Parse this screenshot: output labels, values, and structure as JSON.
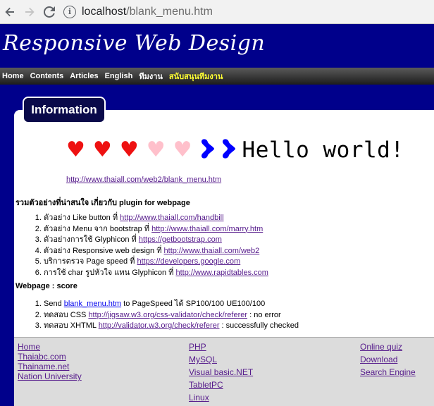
{
  "browser": {
    "url_host": "localhost",
    "url_path": "/blank_menu.htm",
    "back_icon": "arrow-left-icon",
    "forward_icon": "arrow-right-icon",
    "reload_icon": "reload-icon",
    "info_icon": "info-icon"
  },
  "header": {
    "title": "Responsive Web Design",
    "bg_color": "#00008b"
  },
  "menu": {
    "items": [
      {
        "label": "Home"
      },
      {
        "label": "Contents"
      },
      {
        "label": "Articles"
      },
      {
        "label": "English"
      },
      {
        "label": "ทีมงาน"
      },
      {
        "label": "สนับสนุนทีมงาน",
        "highlight": true
      }
    ]
  },
  "panel": {
    "tab_label": "Information",
    "hearts": [
      "♥",
      "♥",
      "♥",
      "♥",
      "♥",
      "♥",
      "♥"
    ],
    "hello": "Hello world!",
    "main_link": "http://www.thaiall.com/web2/blank_menu.htm"
  },
  "section1": {
    "heading": "รวมตัวอย่างที่น่าสนใจ เกี่ยวกับ plugin for webpage",
    "items": [
      {
        "text": "ตัวอย่าง Like button ที่ ",
        "link": "http://www.thaiall.com/handbill"
      },
      {
        "text": "ตัวอย่าง Menu จาก bootstrap ที่ ",
        "link": "http://www.thaiall.com/marry.htm"
      },
      {
        "text": "ตัวอย่างการใช้ Glyphicon ที่ ",
        "link": "https://getbootstrap.com"
      },
      {
        "text": "ตัวอย่าง Responsive web design ที่ ",
        "link": "http://www.thaiall.com/web2"
      },
      {
        "text": "บริการตรวจ Page speed ที่ ",
        "link": "https://developers.google.com"
      },
      {
        "text": "การใช้ char รูปหัวใจ แทน Glyphicon ที่ ",
        "link": "http://www.rapidtables.com"
      }
    ]
  },
  "section2": {
    "heading": "Webpage : score",
    "items": [
      {
        "prefix": "Send ",
        "link": "blank_menu.htm",
        "suffix": " to PageSpeed ได้ SP100/100 UE100/100"
      },
      {
        "prefix": "ทดสอบ CSS ",
        "link": "http://jigsaw.w3.org/css-validator/check/referer",
        "suffix": " : no error"
      },
      {
        "prefix": "ทดสอบ XHTML ",
        "link": "http://validator.w3.org/check/referer",
        "suffix": " : successfully checked"
      }
    ]
  },
  "footer": {
    "col1": [
      "Home",
      "Thaiabc.com",
      "Thainame.net",
      "Nation University"
    ],
    "col2": [
      "PHP",
      "MySQL",
      "Visual basic.NET",
      "TabletPC",
      "Linux"
    ],
    "col3": [
      "Online quiz",
      "Download",
      "Search Engine"
    ]
  }
}
